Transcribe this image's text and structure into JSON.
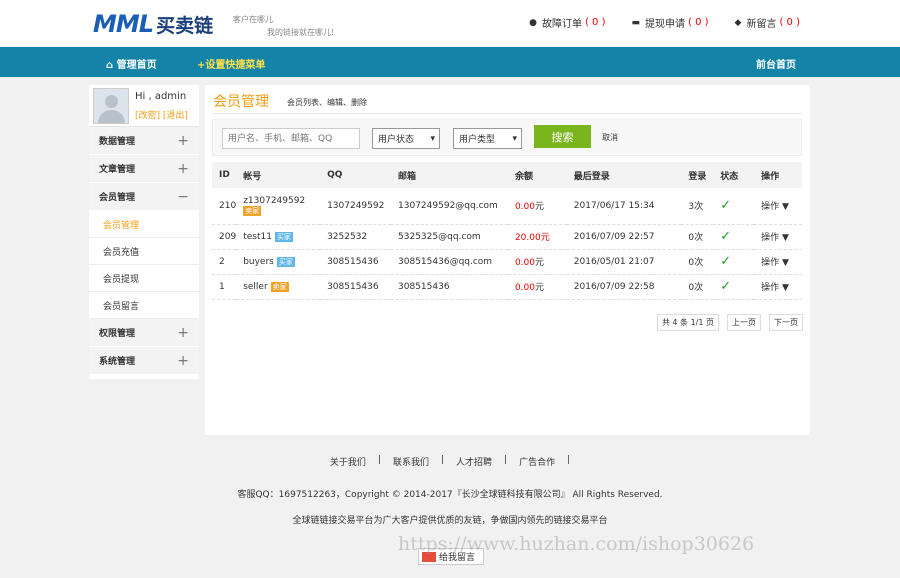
{
  "header": {
    "logo_mark": "MML",
    "logo_text": "买卖链",
    "slogan_1": "客户在哪儿",
    "slogan_2": "我的链接就在哪儿!",
    "nav": [
      {
        "label": "故障订单",
        "count": "( 0 )"
      },
      {
        "label": "提现申请",
        "count": "( 0 )"
      },
      {
        "label": "新留言",
        "count": "( 0 )"
      }
    ]
  },
  "navbar": {
    "home": "管理首页",
    "quick": "+设置快捷菜单",
    "front": "前台首页"
  },
  "sidebar": {
    "greeting": "Hi , admin",
    "links": "[改密] [退出]",
    "groups": [
      {
        "label": "数据管理",
        "sign": "+"
      },
      {
        "label": "文章管理",
        "sign": "+"
      },
      {
        "label": "会员管理",
        "sign": "−"
      },
      {
        "label": "权限管理",
        "sign": "+"
      },
      {
        "label": "系统管理",
        "sign": "+"
      }
    ],
    "sub_items": [
      "会员管理",
      "会员充值",
      "会员提现",
      "会员留言"
    ]
  },
  "main": {
    "title": "会员管理",
    "subtitle": "会员列表、编辑、删除",
    "search_placeholder": "用户名、手机、邮箱、QQ",
    "status_select": "用户状态",
    "type_select": "用户类型",
    "search_button": "搜索",
    "cancel": "取消",
    "columns": [
      "ID",
      "帐号",
      "QQ",
      "邮箱",
      "余额",
      "最后登录",
      "登录",
      "状态",
      "操作"
    ],
    "rows": [
      {
        "id": "210",
        "account": "z1307249592",
        "tag": "卖家",
        "qq": "1307249592",
        "email": "1307249592@qq.com",
        "balance": "0.00",
        "unit": "元",
        "last_login": "2017/06/17 15:34",
        "logins": "3次",
        "status": "✓",
        "op": "操作 ▼"
      },
      {
        "id": "209",
        "account": "test11",
        "tag": "买家",
        "qq": "3252532",
        "email": "5325325@qq.com",
        "balance": "20.00",
        "unit": "元",
        "last_login": "2016/07/09 22:57",
        "logins": "0次",
        "status": "✓",
        "op": "操作 ▼"
      },
      {
        "id": "2",
        "account": "buyers",
        "tag": "买家",
        "qq": "308515436",
        "email": "308515436@qq.com",
        "balance": "0.00",
        "unit": "元",
        "last_login": "2016/05/01 21:07",
        "logins": "0次",
        "status": "✓",
        "op": "操作 ▼"
      },
      {
        "id": "1",
        "account": "seller",
        "tag": "卖家",
        "qq": "308515436",
        "email": "308515436",
        "balance": "0.00",
        "unit": "元",
        "last_login": "2016/07/09 22:58",
        "logins": "0次",
        "status": "✓",
        "op": "操作 ▼"
      }
    ],
    "pager": {
      "info": "共 4 条 1/1 页",
      "prev": "上一页",
      "next": "下一页"
    }
  },
  "footer": {
    "links": [
      "关于我们",
      "|",
      "联系我们",
      "|",
      "人才招聘",
      "|",
      "广告合作",
      "|"
    ],
    "copyright": "客服QQ：1697512263，Copyright © 2014-2017『长沙全球链科技有限公司』 All Rights Reserved.",
    "slogan": "全球链链接交易平台为广大客户提供优质的友链，争做国内领先的链接交易平台",
    "message_button": "给我留言",
    "watermark": "https://www.huzhan.com/ishop30626"
  }
}
